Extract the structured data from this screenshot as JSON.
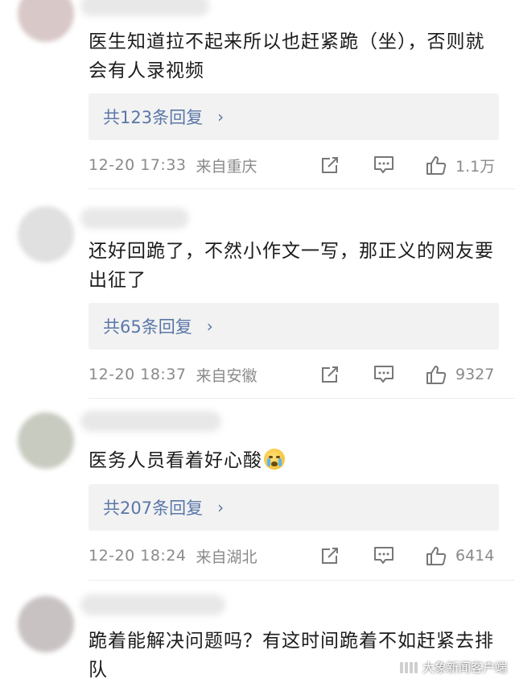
{
  "comments": [
    {
      "text": "医生知道拉不起来所以也赶紧跪（坐），否则就会有人录视频",
      "replies": "共123条回复",
      "time": "12-20 17:33",
      "location": "来自重庆",
      "likes": "1.1万",
      "avatar_color": "#d9c8c8"
    },
    {
      "text": "还好回跪了，不然小作文一写，那正义的网友要出征了",
      "replies": "共65条回复",
      "time": "12-20 18:37",
      "location": "来自安徽",
      "likes": "9327",
      "avatar_color": "#dcdcdc"
    },
    {
      "text": "医务人员看着好心酸",
      "emoji": "crying-face",
      "replies": "共207条回复",
      "time": "12-20 18:24",
      "location": "来自湖北",
      "likes": "6414",
      "avatar_color": "#c8cbc0"
    },
    {
      "text": "跪着能解决问题吗？有这时间跪着不如赶紧去排队",
      "avatar_color": "#c9c2c2"
    }
  ],
  "icons": {
    "share": "share-edit-icon",
    "reply": "comment-icon",
    "like": "thumbs-up-icon",
    "chevron": "chevron-right-icon"
  },
  "chevron_glyph": "›",
  "watermark": "大象新闻客户端",
  "colors": {
    "link": "#5a77a8",
    "reply_bg": "#f2f2f2",
    "meta": "#8a8a8a"
  }
}
